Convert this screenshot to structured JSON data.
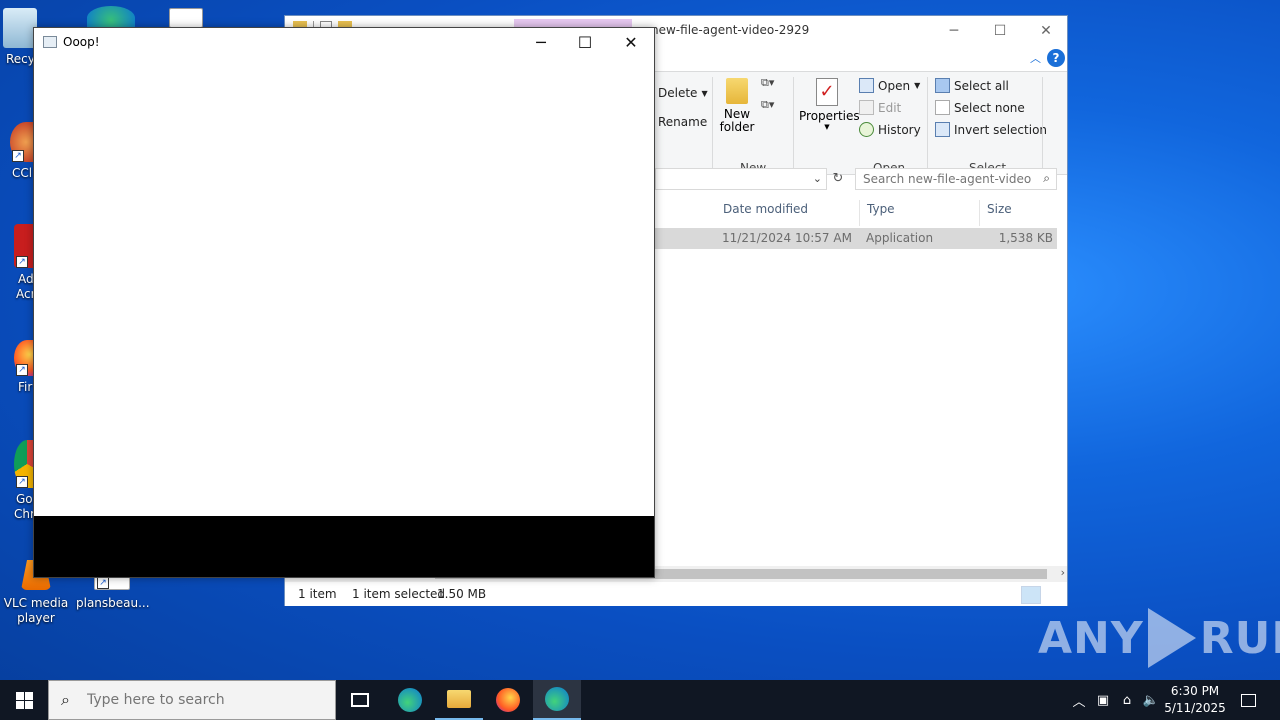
{
  "desktop": {
    "icons": [
      {
        "label": "Recy",
        "icon": "recycle-bin-icon"
      },
      {
        "label": "CCl",
        "icon": "ccleaner-icon"
      },
      {
        "label": "Ad",
        "label2": "Acr",
        "icon": "adobe-acrobat-icon"
      },
      {
        "label": "Fir",
        "icon": "firefox-icon"
      },
      {
        "label": "Go",
        "label2": "Chr",
        "icon": "chrome-icon"
      },
      {
        "label": "VLC media",
        "label2": "player",
        "icon": "vlc-icon"
      },
      {
        "label": "plansbeau...",
        "icon": "document-icon"
      }
    ]
  },
  "explorer": {
    "title": "new-file-agent-video-2929",
    "ribbon": {
      "organize": {
        "delete": "Delete",
        "rename": "Rename"
      },
      "new": {
        "new_folder_line1": "New",
        "new_folder_line2": "folder",
        "group": "New"
      },
      "open": {
        "properties": "Properties",
        "open": "Open",
        "edit": "Edit",
        "history": "History",
        "group": "Open"
      },
      "select": {
        "select_all": "Select all",
        "select_none": "Select none",
        "invert": "Invert selection",
        "group": "Select"
      }
    },
    "search_placeholder": "Search new-file-agent-video-...",
    "columns": {
      "date": "Date modified",
      "type": "Type",
      "size": "Size"
    },
    "row": {
      "date": "11/21/2024 10:57 AM",
      "type": "Application",
      "size": "1,538 KB"
    },
    "status": {
      "items": "1 item",
      "selected": "1 item selected",
      "size": "1.50 MB"
    }
  },
  "popup": {
    "title": "Ooop!"
  },
  "taskbar": {
    "search_placeholder": "Type here to search",
    "time": "6:30 PM",
    "date": "5/11/2025"
  },
  "watermark": {
    "left": "ANY",
    "right": "RUN"
  },
  "colors": {
    "accent": "#1a6fd8",
    "taskbar": "#101723",
    "desktop": "#0a4fc2"
  }
}
